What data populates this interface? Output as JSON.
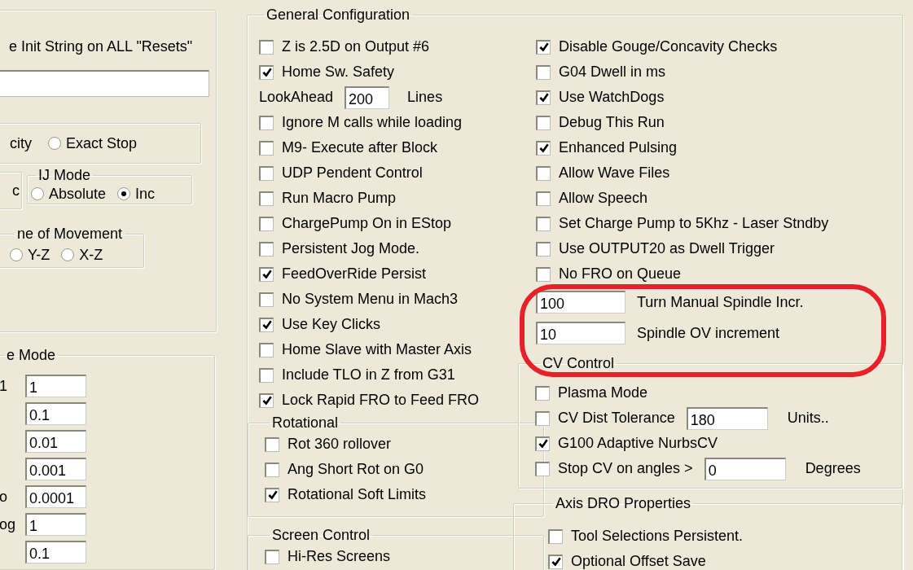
{
  "left": {
    "init_string_label": "e Init String on ALL  \"Resets\"",
    "motion_mode": [
      {
        "kind": "cut",
        "text": "city"
      },
      {
        "kind": "radio",
        "label": "Exact Stop",
        "selected": false
      }
    ],
    "cut_group_text": "c",
    "ij_mode": {
      "title": "IJ Mode",
      "options": [
        {
          "label": "Absolute",
          "selected": false
        },
        {
          "label": "Inc",
          "selected": true
        }
      ]
    },
    "plane": {
      "title": "ne of Movement",
      "options": [
        {
          "label": "Y-Z",
          "selected": false
        },
        {
          "label": "X-Z",
          "selected": false
        }
      ]
    },
    "jog": {
      "title": "e Mode",
      "rows": [
        {
          "label": "1",
          "value": "1"
        },
        {
          "value": "0.1"
        },
        {
          "value": "0.01"
        },
        {
          "value": "0.001"
        },
        {
          "label": "o",
          "value": "0.0001"
        },
        {
          "label": "og",
          "value": "1"
        },
        {
          "value": "0.1"
        }
      ]
    }
  },
  "general": {
    "title": "General Configuration",
    "left_items": [
      {
        "kind": "checkbox",
        "label": "Z is 2.5D on Output #6",
        "checked": false
      },
      {
        "kind": "checkbox",
        "label": "Home Sw. Safety",
        "checked": true
      },
      {
        "kind": "field",
        "label": "LookAhead",
        "value": "200",
        "unit": "Lines"
      },
      {
        "kind": "checkbox",
        "label": "Ignore M calls while loading",
        "checked": false
      },
      {
        "kind": "checkbox",
        "label": "M9- Execute after Block",
        "checked": false
      },
      {
        "kind": "checkbox",
        "label": "UDP Pendent Control",
        "checked": false
      },
      {
        "kind": "checkbox",
        "label": "Run Macro Pump",
        "checked": false
      },
      {
        "kind": "checkbox",
        "label": "ChargePump On in EStop",
        "checked": false
      },
      {
        "kind": "checkbox",
        "label": "Persistent Jog Mode.",
        "checked": false
      },
      {
        "kind": "checkbox",
        "label": "FeedOverRide Persist",
        "checked": true
      },
      {
        "kind": "checkbox",
        "label": "No System Menu in Mach3",
        "checked": false
      },
      {
        "kind": "checkbox",
        "label": "Use Key Clicks",
        "checked": true
      },
      {
        "kind": "checkbox",
        "label": "Home Slave with Master Axis",
        "checked": false
      },
      {
        "kind": "checkbox",
        "label": "Include TLO in Z from G31",
        "checked": false
      },
      {
        "kind": "checkbox",
        "label": "Lock Rapid FRO to Feed FRO",
        "checked": true
      }
    ],
    "right_items": [
      {
        "kind": "checkbox",
        "label": "Disable Gouge/Concavity Checks",
        "checked": true
      },
      {
        "kind": "checkbox",
        "label": "G04 Dwell in ms",
        "checked": false
      },
      {
        "kind": "checkbox",
        "label": "Use WatchDogs",
        "checked": true
      },
      {
        "kind": "checkbox",
        "label": "Debug This Run",
        "checked": false
      },
      {
        "kind": "checkbox",
        "label": "Enhanced Pulsing",
        "checked": true
      },
      {
        "kind": "checkbox",
        "label": "Allow Wave Files",
        "checked": false
      },
      {
        "kind": "checkbox",
        "label": "Allow Speech",
        "checked": false
      },
      {
        "kind": "checkbox",
        "label": "Set Charge Pump to 5Khz  - Laser Stndby",
        "checked": false
      },
      {
        "kind": "checkbox",
        "label": "Use OUTPUT20 as Dwell Trigger",
        "checked": false
      },
      {
        "kind": "checkbox",
        "label": "No FRO on Queue",
        "checked": false
      }
    ]
  },
  "spindle_settings": [
    {
      "label": "Turn Manual Spindle Incr.",
      "value": "100"
    },
    {
      "label": "Spindle OV increment",
      "value": "10"
    }
  ],
  "rotational": {
    "title": "Rotational",
    "items": [
      {
        "kind": "checkbox",
        "label": "Rot 360 rollover",
        "checked": false
      },
      {
        "kind": "checkbox",
        "label": "Ang Short Rot on G0",
        "checked": false
      },
      {
        "kind": "checkbox",
        "label": "Rotational Soft Limits",
        "checked": true
      }
    ]
  },
  "screen_control": {
    "title": "Screen Control",
    "items": [
      {
        "kind": "checkbox",
        "label": "Hi-Res Screens",
        "checked": false
      }
    ]
  },
  "cv_control": {
    "title": "CV Control",
    "items": [
      {
        "kind": "checkbox",
        "label": "Plasma Mode",
        "checked": false
      },
      {
        "kind": "checkbox_field",
        "label": "CV Dist Tolerance",
        "checked": false,
        "value": "180",
        "unit": "Units.."
      },
      {
        "kind": "checkbox",
        "label": "G100 Adaptive NurbsCV",
        "checked": true
      },
      {
        "kind": "checkbox_field",
        "label": "Stop CV on angles >",
        "checked": false,
        "value": "0",
        "unit": "Degrees"
      }
    ]
  },
  "axis_dro": {
    "title": "Axis DRO Properties",
    "items": [
      {
        "kind": "checkbox",
        "label": "Tool Selections Persistent.",
        "checked": false
      },
      {
        "kind": "checkbox",
        "label": "Optional Offset Save",
        "checked": true
      }
    ]
  }
}
